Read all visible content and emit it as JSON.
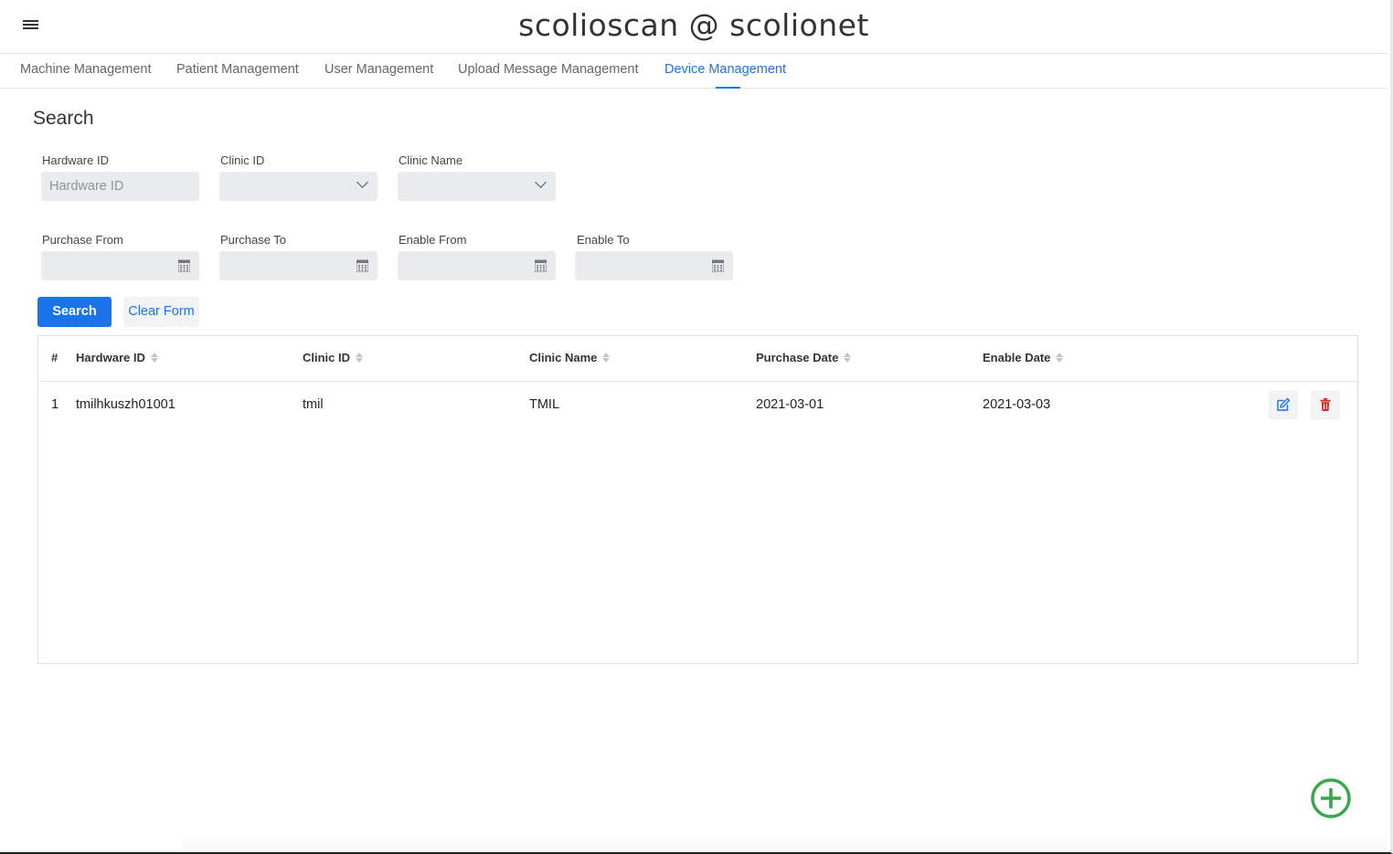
{
  "header": {
    "title": "scolioscan @ scolionet"
  },
  "tabs": [
    {
      "label": "Machine Management"
    },
    {
      "label": "Patient Management"
    },
    {
      "label": "User Management"
    },
    {
      "label": "Upload Message Management"
    },
    {
      "label": "Device Management",
      "active": true
    }
  ],
  "search": {
    "title": "Search",
    "hardware_id": {
      "label": "Hardware ID",
      "placeholder": "Hardware ID",
      "value": ""
    },
    "clinic_id": {
      "label": "Clinic ID",
      "value": ""
    },
    "clinic_name": {
      "label": "Clinic Name",
      "value": ""
    },
    "purchase_from": {
      "label": "Purchase From",
      "value": ""
    },
    "purchase_to": {
      "label": "Purchase To",
      "value": ""
    },
    "enable_from": {
      "label": "Enable From",
      "value": ""
    },
    "enable_to": {
      "label": "Enable To",
      "value": ""
    },
    "search_button": "Search",
    "clear_button": "Clear Form"
  },
  "table": {
    "columns": [
      "#",
      "Hardware ID",
      "Clinic ID",
      "Clinic Name",
      "Purchase Date",
      "Enable Date"
    ],
    "rows": [
      {
        "index": "1",
        "hardware_id": "tmilhkuszh01001",
        "clinic_id": "tmil",
        "clinic_name": "TMIL",
        "purchase_date": "2021-03-01",
        "enable_date": "2021-03-03"
      }
    ]
  },
  "colors": {
    "accent": "#1a73e8",
    "danger": "#e02424",
    "add": "#3aa84a"
  },
  "icons": {
    "menu": "hamburger-menu-icon",
    "edit": "edit-icon",
    "delete": "trash-icon",
    "add": "plus-circle-icon",
    "calendar": "calendar-icon",
    "chevron": "chevron-down-icon",
    "sort": "sort-icon"
  }
}
